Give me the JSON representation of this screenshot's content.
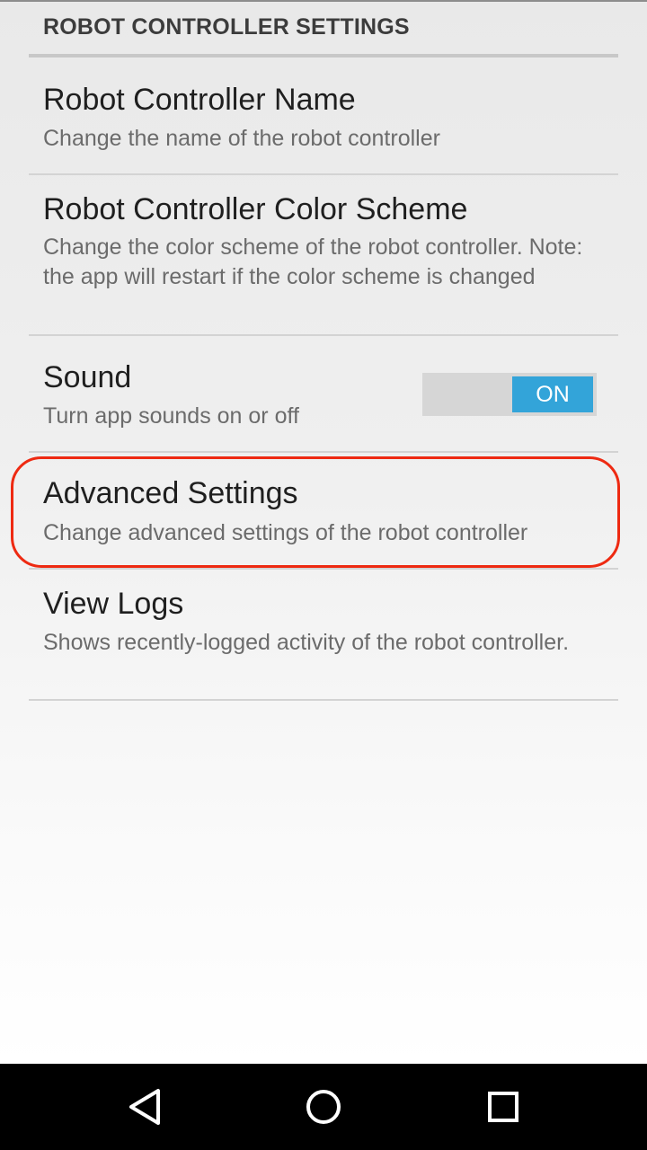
{
  "category": {
    "title": "ROBOT CONTROLLER SETTINGS"
  },
  "preferences": [
    {
      "title": "Robot Controller Name",
      "summary": "Change the name of the robot controller"
    },
    {
      "title": "Robot Controller Color Scheme",
      "summary": "Change the color scheme of the robot controller. Note: the app will restart if the color scheme is changed"
    },
    {
      "title": "Sound",
      "summary": "Turn app sounds on or off",
      "toggle_label": "ON",
      "toggle_state": true
    },
    {
      "title": "Advanced Settings",
      "summary": "Change advanced settings of the robot controller"
    },
    {
      "title": "View Logs",
      "summary": "Shows recently-logged activity of the robot controller."
    }
  ],
  "navbar": {
    "back_icon": "back-triangle-icon",
    "home_icon": "home-circle-icon",
    "recents_icon": "recents-square-icon"
  },
  "colors": {
    "accent": "#33a4d9",
    "highlight": "#ee2a12"
  }
}
